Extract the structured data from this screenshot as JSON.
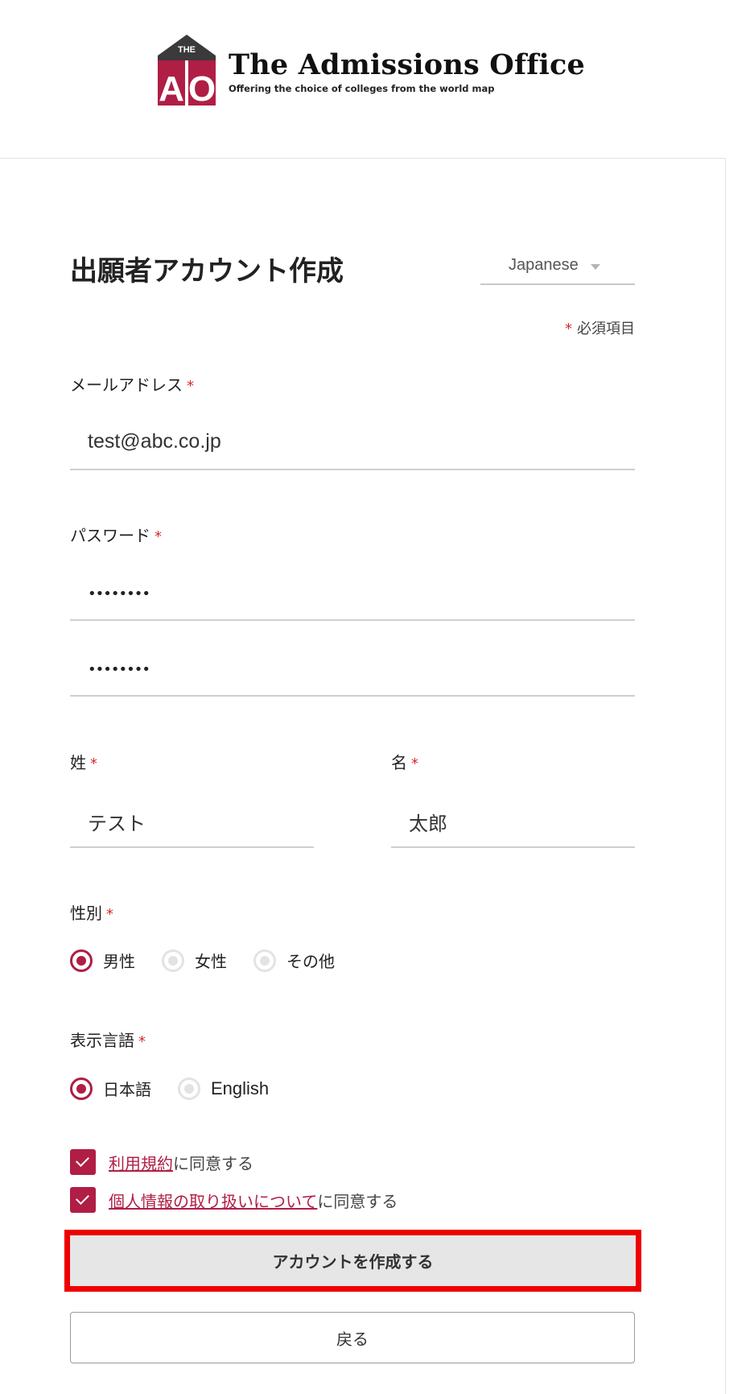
{
  "header": {
    "logo_mark_top": "THE",
    "logo_mark_letters": "AO",
    "logo_title": "The Admissions Office",
    "logo_tagline": "Offering the choice of colleges from the world map"
  },
  "form": {
    "title": "出願者アカウント作成",
    "language_select": {
      "value": "Japanese"
    },
    "required_star": "*",
    "required_note": "必須項目",
    "email": {
      "label": "メールアドレス",
      "value": "test@abc.co.jp"
    },
    "password": {
      "label": "パスワード",
      "value_mask": "••••••••",
      "confirm_mask": "••••••••"
    },
    "last_name": {
      "label": "姓",
      "value": "テスト"
    },
    "first_name": {
      "label": "名",
      "value": "太郎"
    },
    "gender": {
      "label": "性別",
      "options": [
        "男性",
        "女性",
        "その他"
      ],
      "selected": "男性"
    },
    "display_language": {
      "label": "表示言語",
      "options": [
        "日本語",
        "English"
      ],
      "selected": "日本語"
    },
    "agreements": [
      {
        "link_text": "利用規約",
        "suffix": "に同意する",
        "checked": true
      },
      {
        "link_text": "個人情報の取り扱いについて",
        "suffix": "に同意する",
        "checked": true
      }
    ],
    "submit_label": "アカウントを作成する",
    "back_label": "戻る"
  },
  "colors": {
    "accent": "#b01e45",
    "required": "#d42b2b",
    "highlight_border": "#ee0000"
  }
}
